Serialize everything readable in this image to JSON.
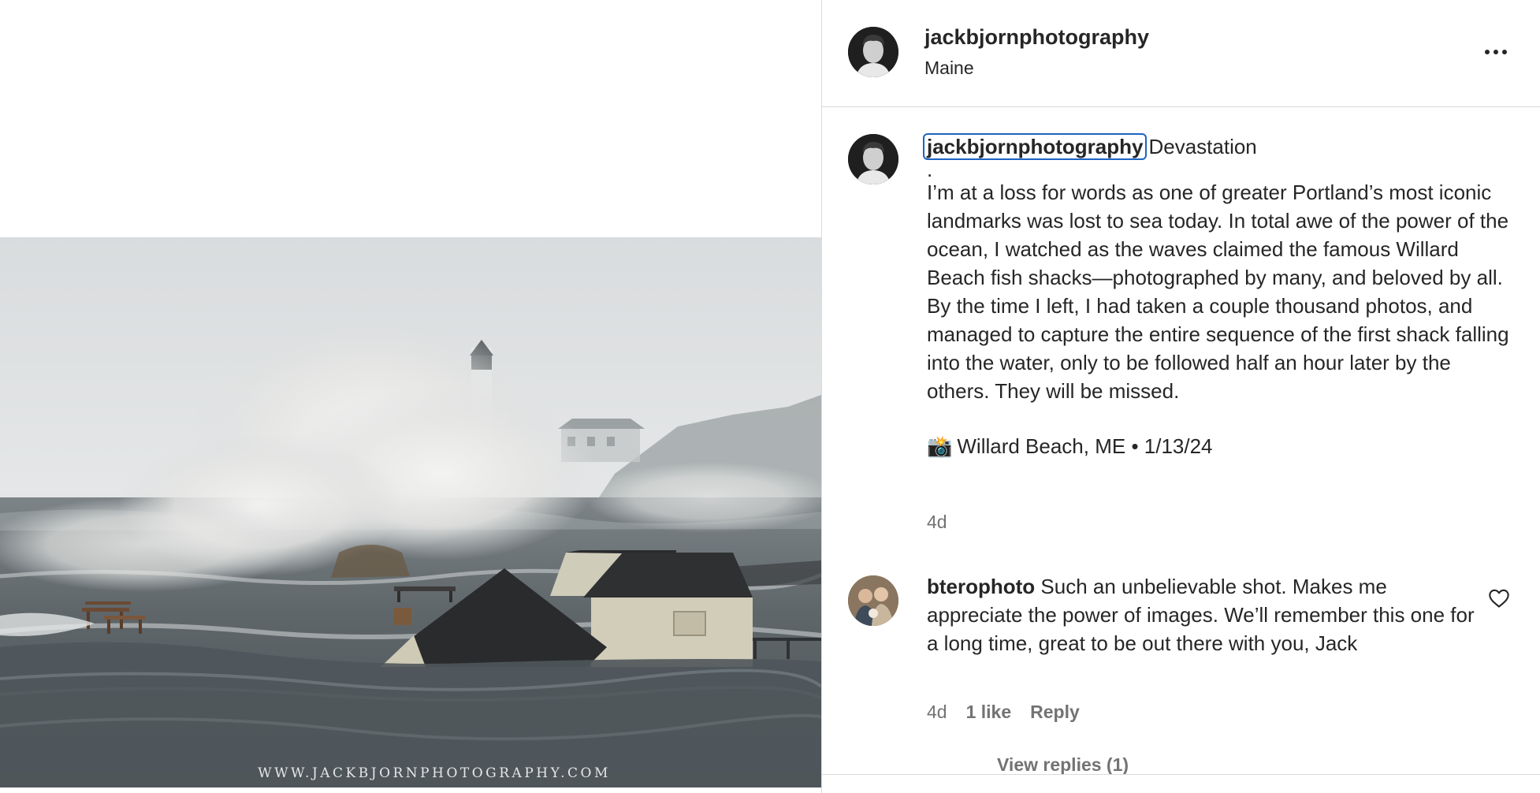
{
  "header": {
    "username": "jackbjornphotography",
    "location": "Maine",
    "more_icon": "more-horizontal-icon"
  },
  "caption": {
    "username": "jackbjornphotography",
    "title": "Devastation",
    "dot": ".",
    "body": "I’m at a loss for words as one of greater Portland’s most iconic landmarks was lost to sea today. In total awe of the power of the ocean, I watched as the waves claimed the famous Willard Beach fish shacks—photographed by many, and beloved by all. By the time I left, I had taken a couple thousand photos, and managed to capture the entire sequence of the first shack falling into the water, only to be followed half an hour later by the others. They will be missed.",
    "camera_emoji": "📸",
    "meta": "Willard Beach, ME • 1/13/24",
    "time_ago": "4d"
  },
  "comment": {
    "username": "bterophoto",
    "text": "Such an unbelievable shot. Makes me appreciate the power of images. We’ll remember this one for a long time, great to be out there with you, Jack",
    "time_ago": "4d",
    "likes": "1 like",
    "reply_label": "Reply",
    "view_replies": "View replies (1)",
    "like_icon": "heart-outline-icon"
  },
  "photo": {
    "watermark": "WWW.JACKBJORNPHOTOGRAPHY.COM"
  }
}
